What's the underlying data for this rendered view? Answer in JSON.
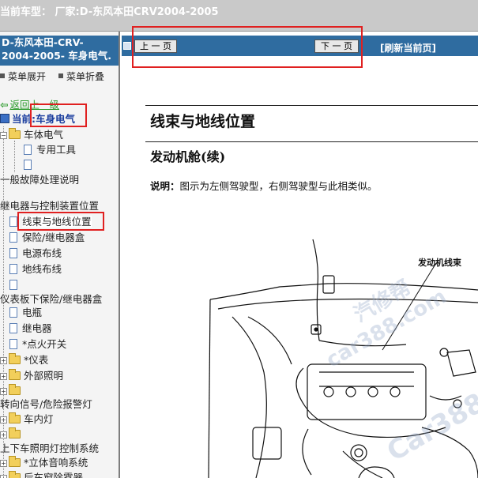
{
  "titlebar": {
    "text": "当前车型： 厂家:D-东风本田CRV2004-2005"
  },
  "sidebar": {
    "header_line1": "D-东风本田-CRV-",
    "header_line2": "2004-2005- 车身电气.",
    "expand_label": "菜单展开",
    "collapse_label": "菜单折叠",
    "back_label": "返回上一级",
    "current_label": "当前:车身电气",
    "items": [
      {
        "label": "车体电气",
        "type": "folder"
      },
      {
        "label": "专用工具",
        "type": "doc"
      },
      {
        "label": "",
        "type": "doc"
      },
      {
        "label": "一般故障处理说明",
        "type": "text"
      },
      {
        "label": "继电器与控制装置位置",
        "type": "text"
      },
      {
        "label": "线束与地线位置",
        "type": "doc",
        "selected": true
      },
      {
        "label": "保险/继电器盒",
        "type": "doc"
      },
      {
        "label": "电源布线",
        "type": "doc"
      },
      {
        "label": "地线布线",
        "type": "doc"
      },
      {
        "label": "",
        "type": "doc"
      },
      {
        "label": "仪表板下保险/继电器盒",
        "type": "text"
      },
      {
        "label": "电瓶",
        "type": "doc"
      },
      {
        "label": "继电器",
        "type": "doc"
      },
      {
        "label": "*点火开关",
        "type": "doc"
      },
      {
        "label": "*仪表",
        "type": "folder"
      },
      {
        "label": "外部照明",
        "type": "folder"
      },
      {
        "label": "",
        "type": "folder"
      },
      {
        "label": "转向信号/危险报警灯",
        "type": "text"
      },
      {
        "label": "车内灯",
        "type": "folder"
      },
      {
        "label": "",
        "type": "folder"
      },
      {
        "label": "上下车照明灯控制系统",
        "type": "text"
      },
      {
        "label": "*立体音响系统",
        "type": "folder"
      },
      {
        "label": "后车窗除雾器",
        "type": "folder"
      }
    ]
  },
  "nav": {
    "prev_label": "上 一 页",
    "next_label": "下 一 页",
    "refresh_label": "[刷新当前页]"
  },
  "document": {
    "title": "线束与地线位置",
    "subtitle": "发动机舱(续)",
    "note_bold": "说明：",
    "note_text": "图示为左侧驾驶型，右侧驾驶型与此相类似。",
    "diagram_label": "发动机线束"
  },
  "watermark": {
    "text1": "汽修帮",
    "text2": "car388.com",
    "text3": "Car388"
  }
}
